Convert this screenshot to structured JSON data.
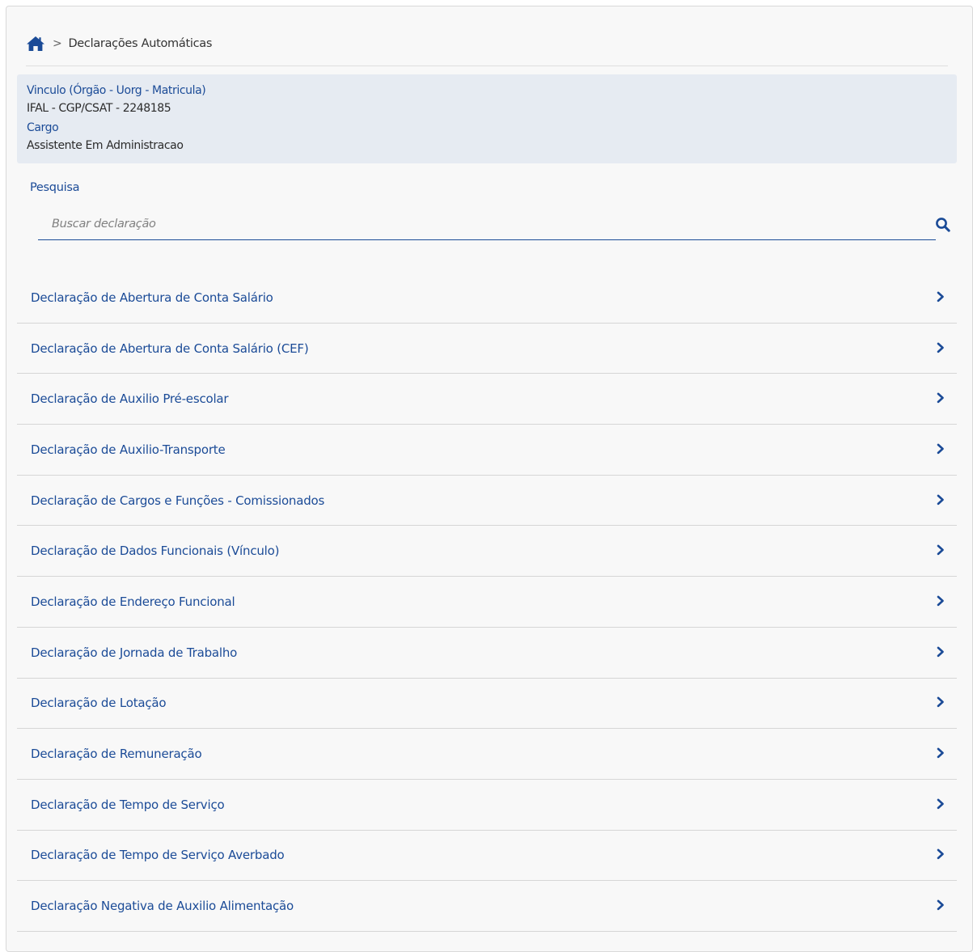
{
  "breadcrumb": {
    "home_icon": "home-icon",
    "separator": ">",
    "current": "Declarações Automáticas"
  },
  "info": {
    "vinculo_label": "Vinculo (Órgão - Uorg - Matricula)",
    "vinculo_value": "IFAL - CGP/CSAT - 2248185",
    "cargo_label": "Cargo",
    "cargo_value": "Assistente Em Administracao"
  },
  "search": {
    "label": "Pesquisa",
    "placeholder": "Buscar declaração",
    "value": "",
    "icon": "search-icon"
  },
  "declarations": [
    {
      "label": "Declaração de Abertura de Conta Salário"
    },
    {
      "label": "Declaração de Abertura de Conta Salário (CEF)"
    },
    {
      "label": "Declaração de Auxilio Pré-escolar"
    },
    {
      "label": "Declaração de Auxilio-Transporte"
    },
    {
      "label": "Declaração de Cargos e Funções - Comissionados"
    },
    {
      "label": "Declaração de Dados Funcionais (Vínculo)"
    },
    {
      "label": "Declaração de Endereço Funcional"
    },
    {
      "label": "Declaração de Jornada de Trabalho"
    },
    {
      "label": "Declaração de Lotação"
    },
    {
      "label": "Declaração de Remuneração"
    },
    {
      "label": "Declaração de Tempo de Serviço"
    },
    {
      "label": "Declaração de Tempo de Serviço Averbado"
    },
    {
      "label": "Declaração Negativa de Auxilio Alimentação"
    }
  ],
  "colors": {
    "accent": "#1b4b97",
    "info_background": "#e6ebf2",
    "panel_background": "#f8f8f8"
  }
}
